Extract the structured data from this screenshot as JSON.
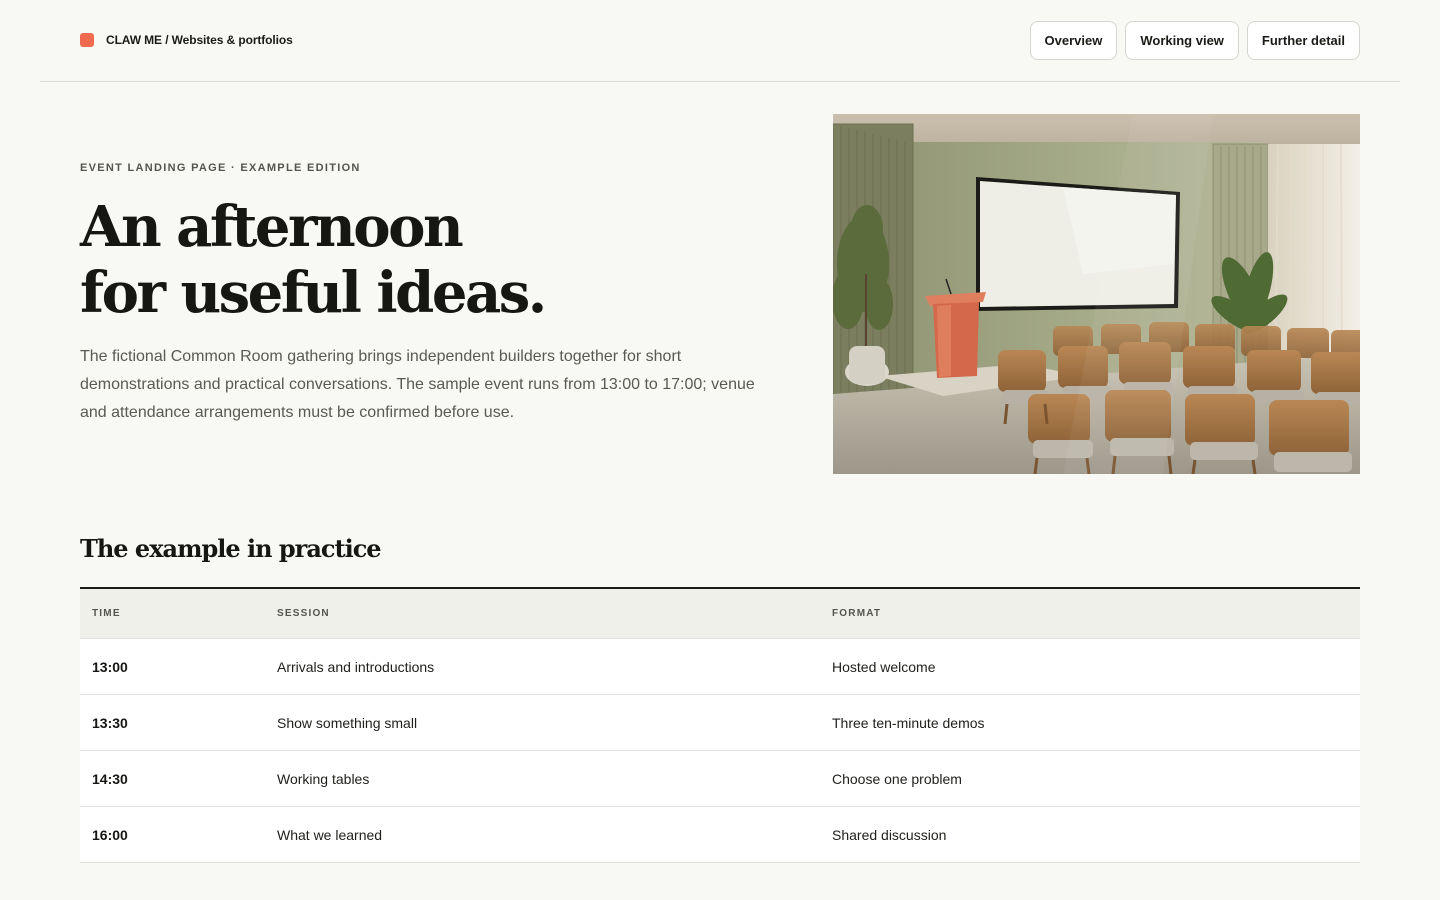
{
  "header": {
    "brand": "CLAW ME / Websites & portfolios",
    "nav": [
      {
        "label": "Overview"
      },
      {
        "label": "Working view"
      },
      {
        "label": "Further detail"
      }
    ]
  },
  "hero": {
    "eyebrow": "EVENT LANDING PAGE · EXAMPLE EDITION",
    "title_line1": "An afternoon",
    "title_line2": "for useful ideas.",
    "description": "The fictional Common Room gathering brings independent builders together for short demonstrations and practical conversations. The sample event runs from 13:00 to 17:00; venue and attendance arrangements must be confirmed before use."
  },
  "section": {
    "title": "The example in practice"
  },
  "schedule": {
    "columns": [
      "TIME",
      "SESSION",
      "FORMAT"
    ],
    "rows": [
      {
        "time": "13:00",
        "session": "Arrivals and introductions",
        "format": "Hosted welcome"
      },
      {
        "time": "13:30",
        "session": "Show something small",
        "format": "Three ten-minute demos"
      },
      {
        "time": "14:30",
        "session": "Working tables",
        "format": "Choose one problem"
      },
      {
        "time": "16:00",
        "session": "What we learned",
        "format": "Shared discussion"
      }
    ]
  },
  "colors": {
    "accent": "#ef6a4f",
    "background": "#f8f8f4",
    "text": "#1a1a17"
  }
}
